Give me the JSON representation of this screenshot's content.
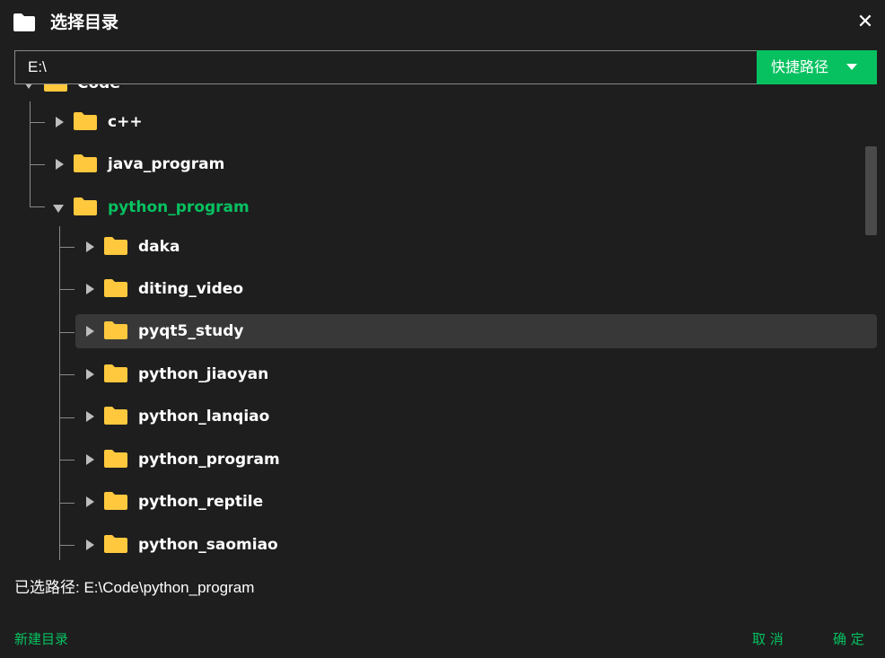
{
  "dialog": {
    "title": "选择目录",
    "close_glyph": "✕",
    "icons": {
      "title": "folder-icon",
      "close": "close-icon",
      "folder": "folder-icon",
      "expand": "triangle-right-icon",
      "collapse": "triangle-down-icon"
    },
    "colors": {
      "accent": "#07c160",
      "folder": "#ffc83d",
      "background": "#1e1e1e",
      "selected_row": "#383838"
    }
  },
  "path_bar": {
    "value": "E:\\",
    "quick_label": "快捷路径"
  },
  "tree": {
    "root": {
      "label": "Code",
      "expanded": true
    },
    "level1": [
      {
        "label": "c++",
        "expanded": false
      },
      {
        "label": "java_program",
        "expanded": false
      },
      {
        "label": "python_program",
        "expanded": true,
        "active": true
      }
    ],
    "level2": [
      {
        "label": "daka"
      },
      {
        "label": "diting_video"
      },
      {
        "label": "pyqt5_study",
        "selected": true
      },
      {
        "label": "python_jiaoyan"
      },
      {
        "label": "python_lanqiao"
      },
      {
        "label": "python_program"
      },
      {
        "label": "python_reptile"
      },
      {
        "label": "python_saomiao"
      }
    ]
  },
  "selected_path_text": "已选路径: E:\\Code\\python_program",
  "footer": {
    "new_dir": "新建目录",
    "cancel": "取 消",
    "confirm": "确 定"
  }
}
